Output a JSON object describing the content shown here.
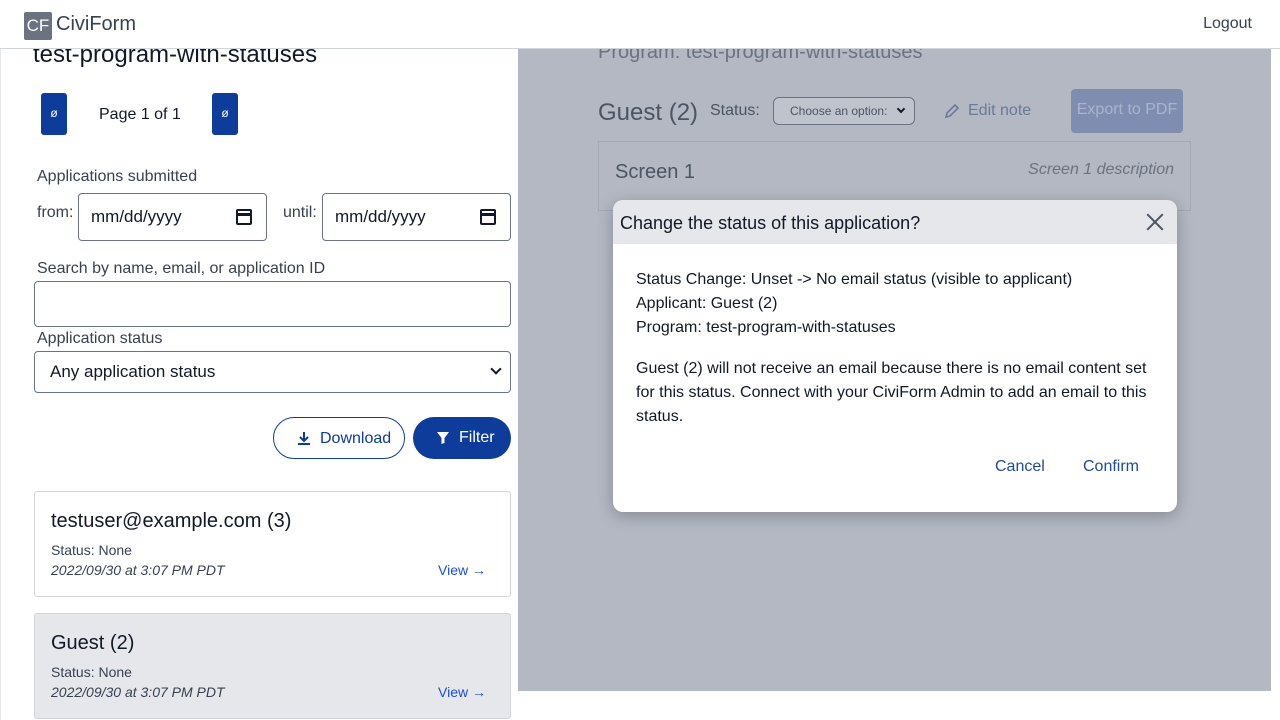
{
  "nav": {
    "logo": "CF",
    "brand": "CiviForm",
    "logout": "Logout"
  },
  "left": {
    "program_title": "test-program-with-statuses",
    "pager": {
      "prev": "ø",
      "text": "Page 1 of 1",
      "next": "ø"
    },
    "submitted_label": "Applications submitted",
    "from_label": "from:",
    "from_value": "mm/dd/yyyy",
    "until_label": "until:",
    "until_value": "mm/dd/yyyy",
    "search_label": "Search by name, email, or application ID",
    "search_value": "",
    "status_label": "Application status",
    "status_selected": "Any application status",
    "download_label": "Download",
    "filter_label": "Filter",
    "applications": [
      {
        "name": "testuser@example.com (3)",
        "status": "Status: None",
        "date": "2022/09/30 at 3:07 PM PDT",
        "view": "View →"
      },
      {
        "name": "Guest (2)",
        "status": "Status: None",
        "date": "2022/09/30 at 3:07 PM PDT",
        "view": "View →"
      }
    ]
  },
  "right": {
    "program": "Program: test-program-with-statuses",
    "applicant": "Guest (2)",
    "status_label": "Status:",
    "status_select": "Choose an option:",
    "edit_note": "Edit note",
    "export": "Export to PDF",
    "screen_title": "Screen 1",
    "screen_desc": "Screen 1 description"
  },
  "modal": {
    "title": "Change the status of this application?",
    "status_change": "Status Change: Unset -> No email status (visible to applicant)",
    "applicant": "Applicant: Guest (2)",
    "program": "Program: test-program-with-statuses",
    "message": "Guest (2) will not receive an email because there is no email content set for this status. Connect with your CiviForm Admin to add an email to this status.",
    "cancel": "Cancel",
    "confirm": "Confirm"
  },
  "colors": {
    "primary": "#0d3c9b",
    "overlay": "#b3b8c2",
    "link": "#1d4ed8"
  }
}
